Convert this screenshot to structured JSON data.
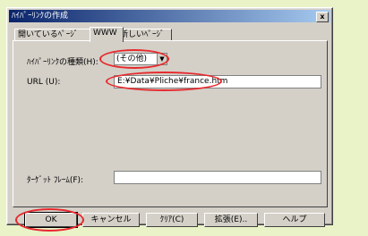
{
  "dialog": {
    "title": "ﾊｲﾊﾟｰﾘﾝｸの作成",
    "close": "x"
  },
  "tabs": [
    {
      "label": "開いているﾍﾟｰｼﾞ"
    },
    {
      "label": "WWW"
    },
    {
      "label": "新しいﾍﾟｰｼﾞ"
    }
  ],
  "form": {
    "type_label": "ﾊｲﾊﾟｰﾘﾝｸの種類(H):",
    "type_value": "(その他)",
    "url_label": "URL (U):",
    "url_value": "E:¥Data¥Pliche¥france.htm",
    "target_label": "ﾀｰｹﾞｯﾄ ﾌﾚｰﾑ(F):",
    "target_value": ""
  },
  "buttons": {
    "ok": "OK",
    "cancel": "キャンセル",
    "clear": "ｸﾘｱ(C)",
    "extend": "拡張(E)..",
    "help": "ヘルプ"
  },
  "colors": {
    "highlight": "#e8282d",
    "page_bg": "#eaf2c8",
    "dialog_bg": "#d4d0c8"
  }
}
